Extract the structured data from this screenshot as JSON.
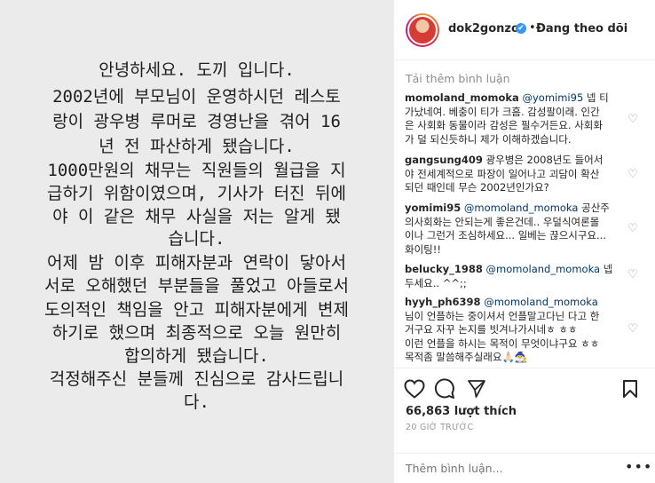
{
  "post": {
    "lines": [
      "안녕하세요. 도끼 입니다.",
      "2002년에 부모님이 운영하시던 레스토",
      "랑이 광우병 루머로 경영난을 겪어 16",
      "년 전 파산하게 됐습니다.",
      "1000만원의 채무는 직원들의 월급을 지",
      "급하기 위함이였으며, 기사가 터진 뒤에",
      "야 이 같은 채무 사실을 저는 알게 됐",
      "습니다.",
      "어제 밤 이후 피해자분과 연락이 닿아서",
      "서로 오해했던 부분들을 풀었고 아들로서",
      "도의적인 책임을 안고 피해자분에게 변제",
      "하기로 했으며 최종적으로 오늘 원만히",
      "합의하게 됐습니다.",
      "걱정해주신 분들께 진심으로 감사드립니",
      "다."
    ]
  },
  "header": {
    "username": "dok2gonzo",
    "verified_icon": "✔",
    "separator": "•",
    "follow_status": "Đang theo dõi"
  },
  "load_more": "Tải thêm bình luận",
  "comments": [
    {
      "user": "momoland_momoka",
      "mention": "@yomimi95",
      "lines": [
        "넵 티",
        "가났네여. 베충이 티가 크흠. 감성팔이래. 인간",
        "은 사회화 동물이라 감성은 필수거든요. 사회화",
        "가 덜 되신듯하니 제가 이해하겠습니다."
      ]
    },
    {
      "user": "gangsung409",
      "mention": "",
      "lines": [
        "광우병은 2008년도 들어서",
        "야 전세계적으로 파장이 일어나고 괴담이 확산",
        "되던 때인데 무슨 2002년인가요?"
      ]
    },
    {
      "user": "yomimi95",
      "mention": "@momoland_momoka",
      "lines": [
        "공산주",
        "의사회화는 안되는게 좋은건데.. 우덜식여론몰",
        "이나 그런거 조심하세요... 일베는 끊으시구요...",
        "화이팅!!"
      ]
    },
    {
      "user": "belucky_1988",
      "mention": "@momoland_momoka",
      "lines": [
        "넵",
        "두세요.. ^^;;"
      ]
    },
    {
      "user": "hyyh_ph6398",
      "mention": "@momoland_momoka",
      "lines": [
        "",
        "님이 언플하는 중이셔서 언플말고다닌 다고 한",
        "거구요 자꾸 논지를 빗겨나가시네ㅎ ㅎㅎ",
        "이런 언플을 하시는 목적이 무엇이냐구요 ㅎㅎ",
        "목적좀 말씀해주실래요🙏🏻🧙‍♂️"
      ]
    }
  ],
  "likes": "66,863 lượt thích",
  "time": "20 GIỜ TRƯỚC",
  "add_comment_placeholder": "Thêm bình luận...",
  "more_icon": "•••",
  "heart_icon": "♡",
  "icons": [
    "heart-icon",
    "comment-icon",
    "share-icon",
    "bookmark-icon"
  ]
}
